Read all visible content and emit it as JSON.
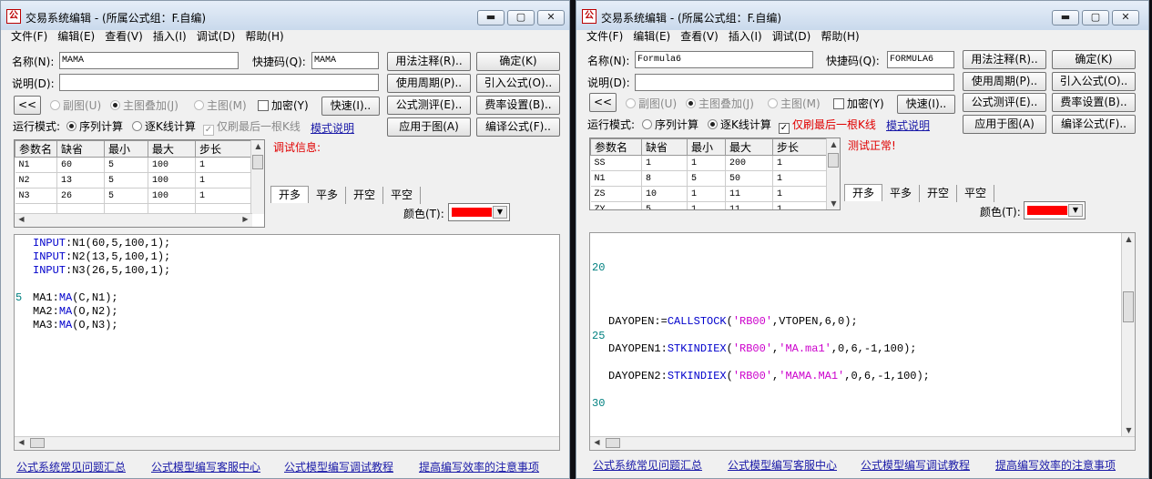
{
  "win1": {
    "title": "交易系统编辑 - (所属公式组：F.自编)",
    "menu": [
      "文件(F)",
      "编辑(E)",
      "查看(V)",
      "插入(I)",
      "调试(D)",
      "帮助(H)"
    ],
    "name_label": "名称(N):",
    "name_value": "MAMA",
    "shortcut_label": "快捷码(Q):",
    "shortcut_value": "MAMA",
    "desc_label": "说明(D):",
    "desc_value": "",
    "collapse_label": "<<",
    "radio_subchart": "副图(U)",
    "radio_main_overlay": "主图叠加(J)",
    "radio_main": "主图(M)",
    "check_encrypt": "加密(Y)",
    "run_mode_label": "运行模式:",
    "run_seq": "序列计算",
    "run_bar": "逐K线计算",
    "only_last": "仅刷最后一根K线",
    "mode_help": "模式说明",
    "buttons": [
      "用法注释(R)..",
      "确定(K)",
      "使用周期(P)..",
      "引入公式(O)..",
      "公式测评(E)..",
      "费率设置(B)..",
      "应用于图(A)",
      "编译公式(F).."
    ],
    "quick_btn": "快速(I)..",
    "param_headers": [
      "参数名",
      "缺省",
      "最小",
      "最大",
      "步长"
    ],
    "params": [
      [
        "N1",
        "60",
        "5",
        "100",
        "1"
      ],
      [
        "N2",
        "13",
        "5",
        "100",
        "1"
      ],
      [
        "N3",
        "26",
        "5",
        "100",
        "1"
      ]
    ],
    "debug_label": "调试信息:",
    "tabs": [
      "开多",
      "平多",
      "开空",
      "平空"
    ],
    "color_label": "颜色(T):",
    "color_value": "#ff0000",
    "line_number": "5",
    "links": [
      "公式系统常见问题汇总",
      "公式模型编写客服中心",
      "公式模型编写调试教程",
      "提高编写效率的注意事项"
    ]
  },
  "win2": {
    "title": "交易系统编辑 - (所属公式组：F.自编)",
    "menu": [
      "文件(F)",
      "编辑(E)",
      "查看(V)",
      "插入(I)",
      "调试(D)",
      "帮助(H)"
    ],
    "name_label": "名称(N):",
    "name_value": "Formula6",
    "shortcut_label": "快捷码(Q):",
    "shortcut_value": "FORMULA6",
    "desc_label": "说明(D):",
    "desc_value": "",
    "collapse_label": "<<",
    "radio_subchart": "副图(U)",
    "radio_main_overlay": "主图叠加(J)",
    "radio_main": "主图(M)",
    "check_encrypt": "加密(Y)",
    "run_mode_label": "运行模式:",
    "run_seq": "序列计算",
    "run_bar": "逐K线计算",
    "only_last": "仅刷最后一根K线",
    "mode_help": "模式说明",
    "buttons": [
      "用法注释(R)..",
      "确定(K)",
      "使用周期(P)..",
      "引入公式(O)..",
      "公式测评(E)..",
      "费率设置(B)..",
      "应用于图(A)",
      "编译公式(F).."
    ],
    "quick_btn": "快速(I)..",
    "param_headers": [
      "参数名",
      "缺省",
      "最小",
      "最大",
      "步长"
    ],
    "params": [
      [
        "SS",
        "1",
        "1",
        "200",
        "1"
      ],
      [
        "N1",
        "8",
        "5",
        "50",
        "1"
      ],
      [
        "ZS",
        "10",
        "1",
        "11",
        "1"
      ],
      [
        "ZY",
        "5",
        "1",
        "11",
        "1"
      ]
    ],
    "debug_label": "测试正常!",
    "tabs": [
      "开多",
      "平多",
      "开空",
      "平空"
    ],
    "color_label": "颜色(T):",
    "color_value": "#ff0000",
    "line_numbers": [
      "20",
      "25",
      "30"
    ],
    "links": [
      "公式系统常见问题汇总",
      "公式模型编写客服中心",
      "公式模型编写调试教程",
      "提高编写效率的注意事项"
    ]
  }
}
